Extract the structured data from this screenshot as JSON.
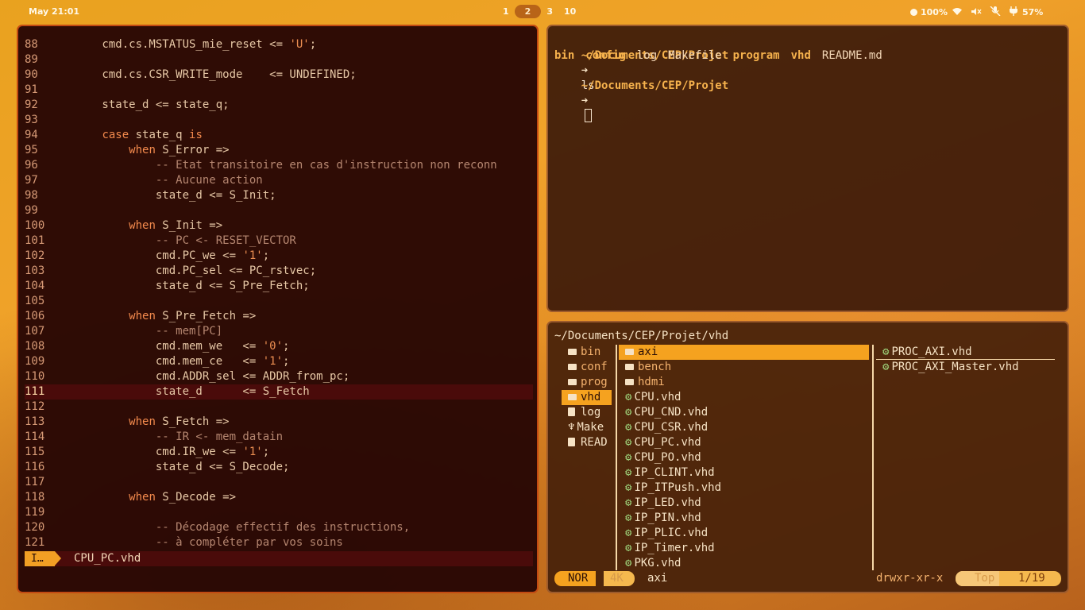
{
  "topbar": {
    "clock": "May 21:01",
    "workspaces": [
      {
        "label": "1",
        "active": false
      },
      {
        "label": "2",
        "active": true
      },
      {
        "label": "3",
        "active": false
      },
      {
        "label": "10",
        "active": false
      }
    ],
    "brightness": "100%",
    "battery": "57%",
    "icons": [
      "brightness-icon",
      "wifi-icon",
      "volume-muted-icon",
      "mic-muted-icon",
      "power-plug-icon"
    ]
  },
  "editor": {
    "lines": [
      {
        "n": "88",
        "t": "        cmd.cs.MSTATUS_mie_reset <= 'U';"
      },
      {
        "n": "89",
        "t": ""
      },
      {
        "n": "90",
        "t": "        cmd.cs.CSR_WRITE_mode    <= UNDEFINED;"
      },
      {
        "n": "91",
        "t": ""
      },
      {
        "n": "92",
        "t": "        state_d <= state_q;"
      },
      {
        "n": "93",
        "t": ""
      },
      {
        "n": "94",
        "t": "        case state_q is"
      },
      {
        "n": "95",
        "t": "            when S_Error =>"
      },
      {
        "n": "96",
        "t": "                -- Etat transitoire en cas d'instruction non reconn"
      },
      {
        "n": "97",
        "t": "                -- Aucune action"
      },
      {
        "n": "98",
        "t": "                state_d <= S_Init;"
      },
      {
        "n": "99",
        "t": ""
      },
      {
        "n": "100",
        "t": "            when S_Init =>"
      },
      {
        "n": "101",
        "t": "                -- PC <- RESET_VECTOR"
      },
      {
        "n": "102",
        "t": "                cmd.PC_we <= '1';"
      },
      {
        "n": "103",
        "t": "                cmd.PC_sel <= PC_rstvec;"
      },
      {
        "n": "104",
        "t": "                state_d <= S_Pre_Fetch;"
      },
      {
        "n": "105",
        "t": ""
      },
      {
        "n": "106",
        "t": "            when S_Pre_Fetch =>"
      },
      {
        "n": "107",
        "t": "                -- mem[PC]"
      },
      {
        "n": "108",
        "t": "                cmd.mem_we   <= '0';"
      },
      {
        "n": "109",
        "t": "                cmd.mem_ce   <= '1';"
      },
      {
        "n": "110",
        "t": "                cmd.ADDR_sel <= ADDR_from_pc;"
      },
      {
        "n": "111",
        "t": "                state_d      <= S_Fetch"
      },
      {
        "n": "112",
        "t": ""
      },
      {
        "n": "113",
        "t": "            when S_Fetch =>"
      },
      {
        "n": "114",
        "t": "                -- IR <- mem_datain"
      },
      {
        "n": "115",
        "t": "                cmd.IR_we <= '1';"
      },
      {
        "n": "116",
        "t": "                state_d <= S_Decode;"
      },
      {
        "n": "117",
        "t": ""
      },
      {
        "n": "118",
        "t": "            when S_Decode =>"
      },
      {
        "n": "119",
        "t": ""
      },
      {
        "n": "120",
        "t": "                -- Décodage effectif des instructions,"
      },
      {
        "n": "121",
        "t": "                -- à compléter par vos soins"
      }
    ],
    "current_line": "111",
    "mode": "I…",
    "filename": "CPU_PC.vhd"
  },
  "terminal": {
    "prompt_path": "~/Documents/CEP/Projet",
    "prompt_arrow": "➜",
    "command": "ls",
    "ls_output": [
      {
        "name": "bin",
        "dir": true
      },
      {
        "name": "config",
        "dir": true
      },
      {
        "name": "log",
        "dir": false
      },
      {
        "name": "Makefile",
        "dir": false
      },
      {
        "name": "program",
        "dir": true
      },
      {
        "name": "vhd",
        "dir": true
      },
      {
        "name": "README.md",
        "dir": false
      }
    ]
  },
  "filemgr": {
    "path": "~/Documents/CEP/Projet/vhd",
    "parent": [
      {
        "name": "bin",
        "icon": "folder-icon",
        "dir": true
      },
      {
        "name": "conf",
        "icon": "folder-icon",
        "dir": true
      },
      {
        "name": "prog",
        "icon": "folder-icon",
        "dir": true
      },
      {
        "name": "vhd",
        "icon": "folder-icon",
        "dir": true,
        "selected": true
      },
      {
        "name": "log",
        "icon": "file-icon",
        "dir": false
      },
      {
        "name": "Make",
        "icon": "makefile-icon",
        "dir": false
      },
      {
        "name": "READ",
        "icon": "readme-icon",
        "dir": false
      }
    ],
    "current": [
      {
        "name": "axi",
        "icon": "folder-icon",
        "dir": true,
        "selected": true
      },
      {
        "name": "bench",
        "icon": "folder-icon",
        "dir": true
      },
      {
        "name": "hdmi",
        "icon": "folder-icon",
        "dir": true
      },
      {
        "name": "CPU.vhd",
        "icon": "gear-icon"
      },
      {
        "name": "CPU_CND.vhd",
        "icon": "gear-icon"
      },
      {
        "name": "CPU_CSR.vhd",
        "icon": "gear-icon"
      },
      {
        "name": "CPU_PC.vhd",
        "icon": "gear-icon"
      },
      {
        "name": "CPU_PO.vhd",
        "icon": "gear-icon"
      },
      {
        "name": "IP_CLINT.vhd",
        "icon": "gear-icon"
      },
      {
        "name": "IP_ITPush.vhd",
        "icon": "gear-icon"
      },
      {
        "name": "IP_LED.vhd",
        "icon": "gear-icon"
      },
      {
        "name": "IP_PIN.vhd",
        "icon": "gear-icon"
      },
      {
        "name": "IP_PLIC.vhd",
        "icon": "gear-icon"
      },
      {
        "name": "IP_Timer.vhd",
        "icon": "gear-icon"
      },
      {
        "name": "PKG.vhd",
        "icon": "gear-icon"
      }
    ],
    "preview": [
      {
        "name": "PROC_AXI.vhd",
        "icon": "gear-icon",
        "hover": true
      },
      {
        "name": "PROC_AXI_Master.vhd",
        "icon": "gear-icon"
      }
    ],
    "status": {
      "mode": "NOR",
      "size": "4K",
      "current": "axi",
      "permissions": "drwxr-xr-x",
      "scroll": "Top",
      "position": "1/19"
    }
  }
}
